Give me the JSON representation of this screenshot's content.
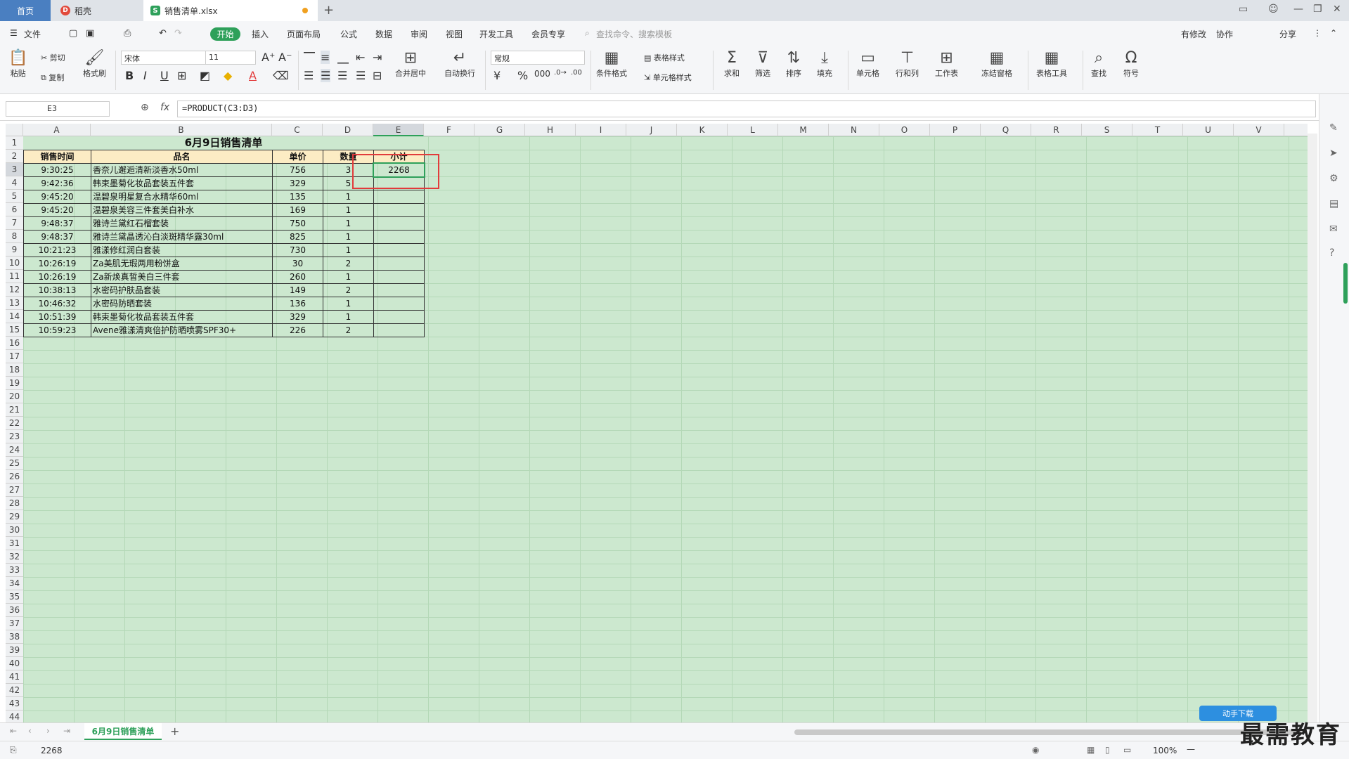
{
  "tabs": {
    "home": "首页",
    "docer": "稻壳",
    "file": "销售清单.xlsx"
  },
  "menu": {
    "file": "文件",
    "start": "开始",
    "items": [
      "插入",
      "页面布局",
      "公式",
      "数据",
      "审阅",
      "视图",
      "开发工具",
      "会员专享"
    ],
    "search_placeholder": "查找命令、搜索模板",
    "share": "分享",
    "sync": "有修改",
    "cooperate": "协作"
  },
  "ribbon": {
    "paste": "粘贴",
    "cut": "剪切",
    "copy": "复制",
    "format_painter": "格式刷",
    "font": "宋体",
    "size": "11",
    "number_format": "常规",
    "merge": "合并居中",
    "wrap": "自动换行",
    "cond_format": "条件格式",
    "table_style": "表格样式",
    "cell_style": "单元格样式",
    "sum": "求和",
    "filter": "筛选",
    "sort": "排序",
    "fill": "填充",
    "cell": "单元格",
    "rowcol": "行和列",
    "sheet": "工作表",
    "freeze": "冻结窗格",
    "table_tools": "表格工具",
    "find": "查找",
    "symbol": "符号"
  },
  "formula_bar": {
    "name": "E3",
    "formula": "=PRODUCT(C3:D3)"
  },
  "columns": [
    "A",
    "B",
    "C",
    "D",
    "E",
    "F",
    "G",
    "H",
    "I",
    "J",
    "K",
    "L",
    "M",
    "N",
    "O",
    "P",
    "Q",
    "R",
    "S",
    "T",
    "U",
    "V"
  ],
  "title": "6月9日销售清单",
  "headers": [
    "销售时间",
    "品名",
    "单价",
    "数量",
    "小计"
  ],
  "rows": [
    [
      "9:30:25",
      "香奈儿邂逅清新淡香水50ml",
      "756",
      "3",
      "2268"
    ],
    [
      "9:42:36",
      "韩束墨菊化妆品套装五件套",
      "329",
      "5",
      ""
    ],
    [
      "9:45:20",
      "温碧泉明星复合水精华60ml",
      "135",
      "1",
      ""
    ],
    [
      "9:45:20",
      "温碧泉美容三件套美白补水",
      "169",
      "1",
      ""
    ],
    [
      "9:48:37",
      "雅诗兰黛红石榴套装",
      "750",
      "1",
      ""
    ],
    [
      "9:48:37",
      "雅诗兰黛晶透沁白淡斑精华露30ml",
      "825",
      "1",
      ""
    ],
    [
      "10:21:23",
      "雅漾修红润白套装",
      "730",
      "1",
      ""
    ],
    [
      "10:26:19",
      "Za美肌无瑕两用粉饼盒",
      "30",
      "2",
      ""
    ],
    [
      "10:26:19",
      "Za新焕真皙美白三件套",
      "260",
      "1",
      ""
    ],
    [
      "10:38:13",
      "水密码护肤品套装",
      "149",
      "2",
      ""
    ],
    [
      "10:46:32",
      "水密码防晒套装",
      "136",
      "1",
      ""
    ],
    [
      "10:51:39",
      "韩束墨菊化妆品套装五件套",
      "329",
      "1",
      ""
    ],
    [
      "10:59:23",
      "Avene雅漾清爽倍护防晒喷雾SPF30+",
      "226",
      "2",
      ""
    ]
  ],
  "row_count": 44,
  "sheet_name": "6月9日销售清单",
  "status": {
    "value": "2268",
    "zoom": "100%"
  },
  "watermark": "最需教育",
  "sogou": "动手下载"
}
